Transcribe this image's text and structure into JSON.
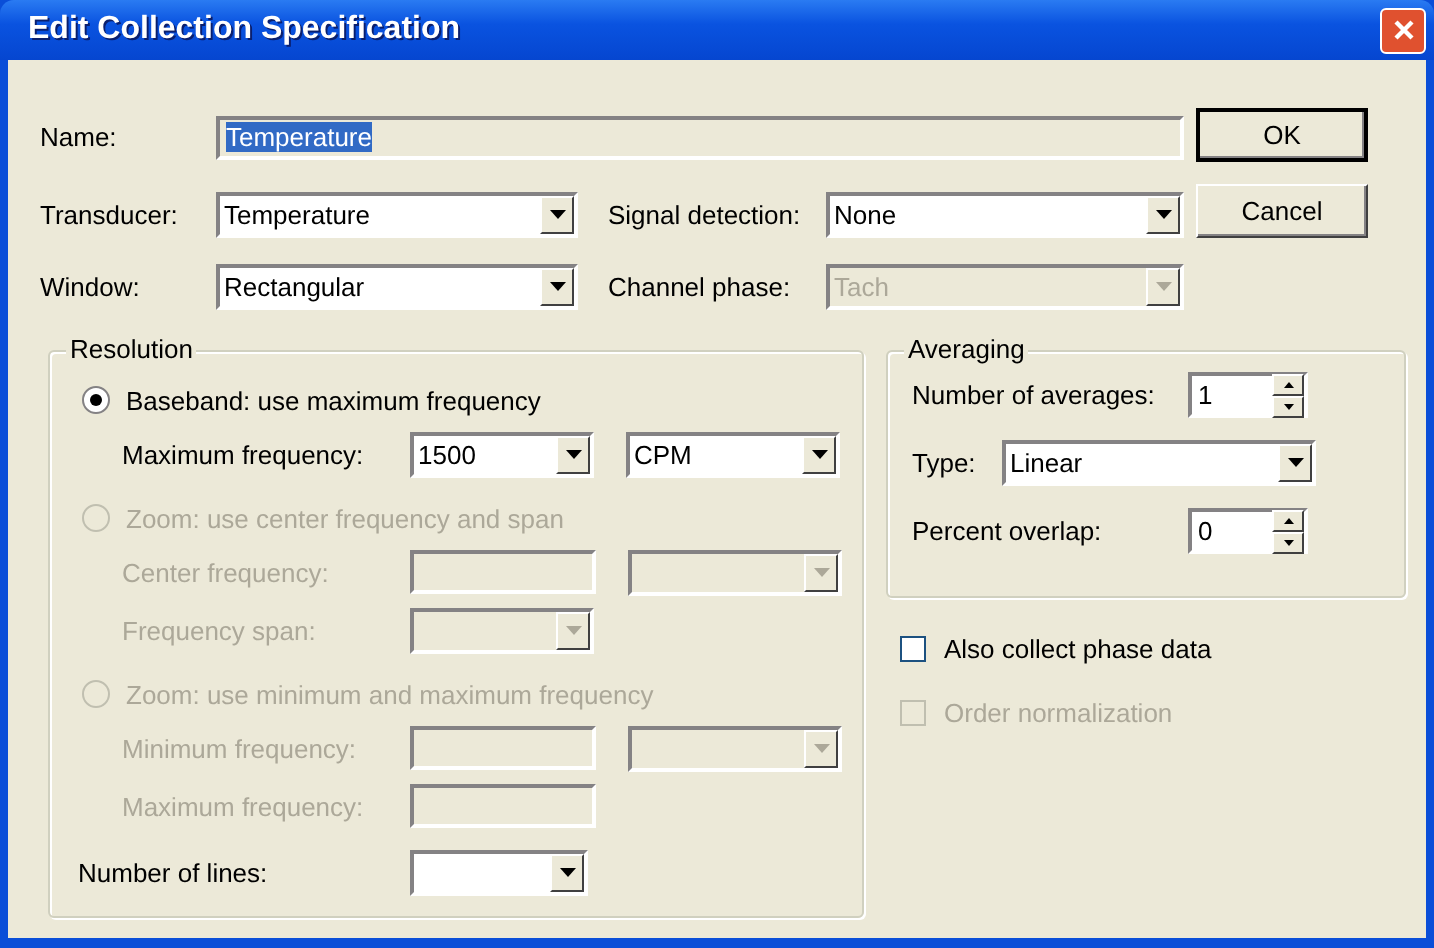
{
  "window": {
    "title": "Edit Collection Specification"
  },
  "name": {
    "label": "Name:",
    "value": "Temperature",
    "text_selected": true
  },
  "fields": [
    {
      "label": "Transducer:",
      "value": "Temperature",
      "disabled": false
    },
    {
      "label": "Signal detection:",
      "value": "None",
      "disabled": false
    },
    {
      "label": "Window:",
      "value": "Rectangular",
      "disabled": false
    },
    {
      "label": "Channel phase:",
      "value": "Tach",
      "disabled": true
    }
  ],
  "buttons": [
    {
      "label": "OK",
      "default": true
    },
    {
      "label": "Cancel",
      "default": false
    }
  ],
  "resolution": {
    "title": "Resolution",
    "options": [
      {
        "label": "Baseband: use maximum frequency",
        "selected": true,
        "disabled": false,
        "rows": [
          {
            "label": "Maximum frequency:",
            "controls": [
              {
                "kind": "combo",
                "value": "1500"
              },
              {
                "kind": "combo",
                "value": "CPM"
              }
            ]
          }
        ]
      },
      {
        "label": "Zoom: use center frequency and span",
        "selected": false,
        "disabled": true,
        "rows": [
          {
            "label": "Center frequency:",
            "controls": [
              {
                "kind": "text"
              },
              {
                "kind": "combo"
              }
            ]
          },
          {
            "label": "Frequency span:",
            "controls": [
              {
                "kind": "combo"
              }
            ]
          }
        ]
      },
      {
        "label": "Zoom: use minimum and maximum frequency",
        "selected": false,
        "disabled": true,
        "rows": [
          {
            "label": "Minimum frequency:",
            "controls": [
              {
                "kind": "text"
              },
              {
                "kind": "combo"
              }
            ]
          },
          {
            "label": "Maximum frequency:",
            "controls": [
              {
                "kind": "text"
              }
            ]
          }
        ]
      }
    ],
    "lines": {
      "label": "Number of lines:",
      "disabled": false
    }
  },
  "averaging": {
    "title": "Averaging",
    "rows": [
      {
        "kind": "spin",
        "label": "Number of averages:",
        "value": "1"
      },
      {
        "kind": "combo",
        "label": "Type:",
        "value": "Linear"
      },
      {
        "kind": "spin",
        "label": "Percent overlap:",
        "value": "0"
      }
    ]
  },
  "checks": [
    {
      "label": "Also collect phase data",
      "checked": false,
      "disabled": false
    },
    {
      "label": "Order normalization",
      "checked": false,
      "disabled": true
    }
  ]
}
